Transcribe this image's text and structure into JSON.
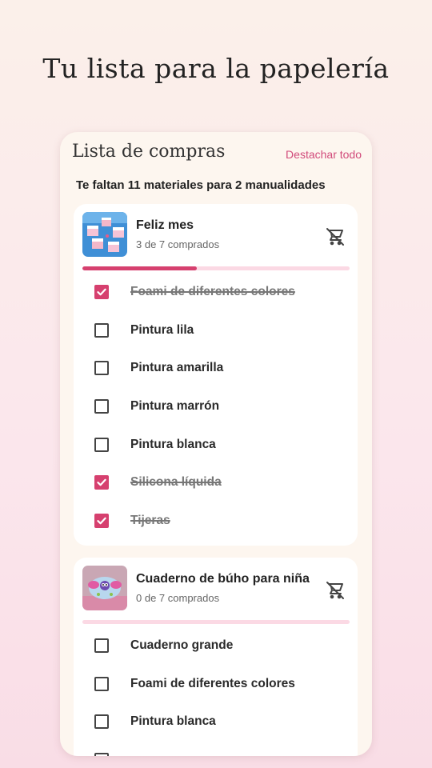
{
  "headline": "Tu lista para la papelería",
  "app": {
    "title": "Lista de compras",
    "unmark_all": "Destachar todo",
    "summary": "Te faltan 11 materiales para 2 manualidades"
  },
  "projects": [
    {
      "title": "Feliz mes",
      "subtitle": "3 de 7 comprados",
      "progress": 0.4286,
      "thumb_icon": "cake-cards-photo",
      "items": [
        {
          "label": "Foami de diferentes colores",
          "checked": true
        },
        {
          "label": "Pintura lila",
          "checked": false
        },
        {
          "label": "Pintura amarilla",
          "checked": false
        },
        {
          "label": "Pintura marrón",
          "checked": false
        },
        {
          "label": "Pintura blanca",
          "checked": false
        },
        {
          "label": "Silicona líquida",
          "checked": true
        },
        {
          "label": "Tijeras",
          "checked": true
        }
      ]
    },
    {
      "title": "Cuaderno de búho para niña",
      "subtitle": "0 de 7 comprados",
      "progress": 0,
      "thumb_icon": "owl-notebook-photo",
      "items": [
        {
          "label": "Cuaderno grande",
          "checked": false
        },
        {
          "label": "Foami de diferentes colores",
          "checked": false
        },
        {
          "label": "Pintura blanca",
          "checked": false
        }
      ]
    }
  ],
  "colors": {
    "accent": "#d6406f",
    "progress_track": "#fbd9e4",
    "card_bg": "#ffffff",
    "panel_bg": "#fdf6ef"
  },
  "icons": {
    "remove_cart": "remove-shopping-cart-icon",
    "checkbox": "checkbox-icon"
  }
}
